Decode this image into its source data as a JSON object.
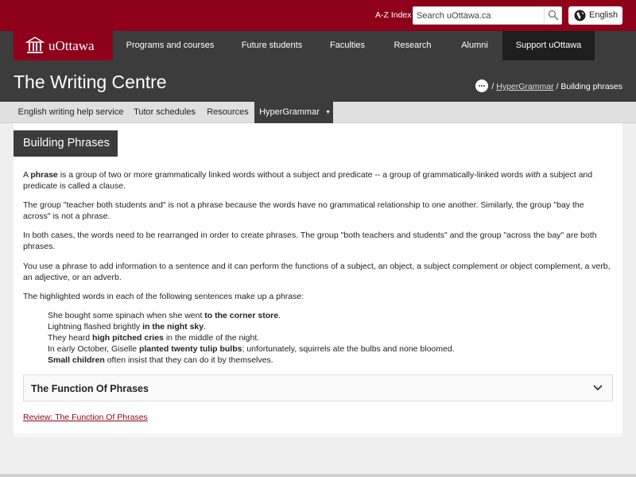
{
  "topbar": {
    "az_index": "A-Z Index",
    "search_placeholder": "Search uOttawa.ca",
    "language": "English"
  },
  "brand": {
    "logo_text": "uOttawa"
  },
  "main_nav": [
    {
      "label": "Programs and courses"
    },
    {
      "label": "Future students"
    },
    {
      "label": "Faculties"
    },
    {
      "label": "Research"
    },
    {
      "label": "Alumni"
    },
    {
      "label": "Support uOttawa"
    }
  ],
  "site_title": "The Writing Centre",
  "breadcrumb": {
    "sep": "/",
    "parent": "HyperGrammar",
    "current": "Building phrases"
  },
  "sub_nav": [
    {
      "label": "English writing help service"
    },
    {
      "label": "Tutor schedules"
    },
    {
      "label": "Resources"
    },
    {
      "label": "HyperGrammar",
      "arrow": "▼"
    }
  ],
  "page": {
    "heading": "Building Phrases",
    "p1": {
      "a": "A ",
      "b": "phrase",
      "c": " is a group of two or more grammatically linked words without a subject and predicate -- a group of grammatically-linked words ",
      "d": "with",
      "e": " a subject and predicate is called a clause."
    },
    "p2": "The group \"teacher both students and\" is not a phrase because the words have no grammatical relationship to one another. Similarly, the group \"bay the across\" is not a phrase.",
    "p3": "In both cases, the words need to be rearranged in order to create phrases. The group \"both teachers and students\" and the group \"across the bay\" are both phrases.",
    "p4": "You use a phrase to add information to a sentence and it can perform the functions of a subject, an object, a subject complement or object complement, a verb, an adjective, or an adverb.",
    "p5": "The highlighted words in each of the following sentences make up a phrase:",
    "examples": [
      {
        "before": "She bought some spinach when she went ",
        "phrase": "to the corner store",
        "after": "."
      },
      {
        "before": "Lightning flashed brightly ",
        "phrase": "in the night sky",
        "after": "."
      },
      {
        "before": "They heard ",
        "phrase": "high pitched cries",
        "after": " in the middle of the night."
      },
      {
        "before": "In early October, Giselle ",
        "phrase": "planted twenty tulip bulbs",
        "after": "; unfortunately, squirrels ate the bulbs and none bloomed."
      },
      {
        "before": "",
        "phrase": "Small children",
        "after": " often insist that they can do it by themselves."
      }
    ],
    "accordion_title": "The Function Of Phrases",
    "review_link": "Review: The Function Of Phrases"
  },
  "colors": {
    "brand": "#8f001a",
    "dark": "#3c3c3c"
  },
  "icons": [
    "search-icon",
    "globe-icon",
    "university-building-icon",
    "more-dots-icon",
    "chevron-down-icon"
  ]
}
